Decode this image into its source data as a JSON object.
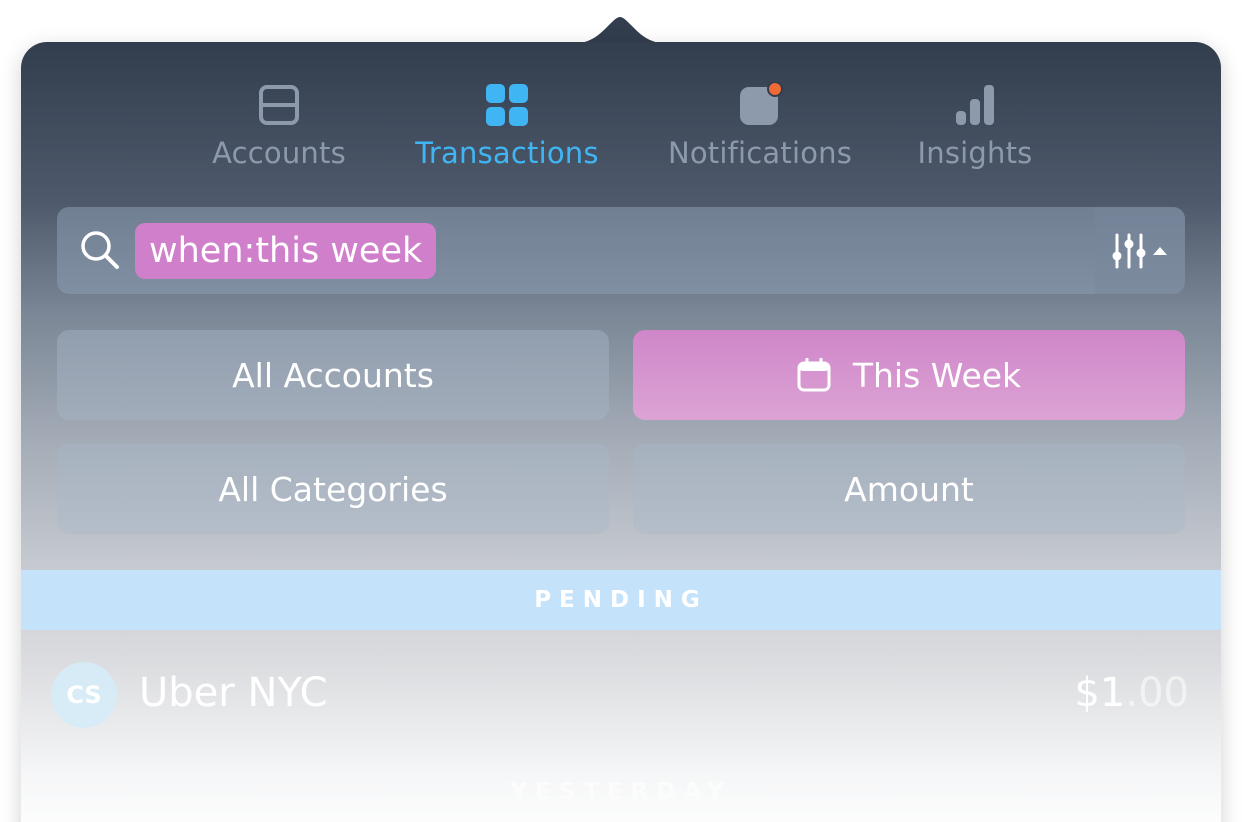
{
  "tabs": [
    {
      "label": "Accounts",
      "icon": "accounts-icon",
      "active": false
    },
    {
      "label": "Transactions",
      "icon": "transactions-icon",
      "active": true
    },
    {
      "label": "Notifications",
      "icon": "notifications-icon",
      "active": false
    },
    {
      "label": "Insights",
      "icon": "insights-icon",
      "active": false
    }
  ],
  "colors": {
    "accent": "#3fb6f3",
    "inactive_tab": "#8c9aab",
    "token": "#d07fcb",
    "notification_dot": "#f06a35",
    "pending_header": "#c5e2fb"
  },
  "search": {
    "token": "when:this week"
  },
  "filters": {
    "accounts": "All Accounts",
    "date": "This Week",
    "categories": "All Categories",
    "amount": "Amount"
  },
  "sections": {
    "pending": "PENDING",
    "yesterday": "YESTERDAY"
  },
  "transactions": [
    {
      "initials": "CS",
      "merchant": "Uber NYC",
      "amount_main": "$1",
      "amount_cents": ".00"
    }
  ]
}
